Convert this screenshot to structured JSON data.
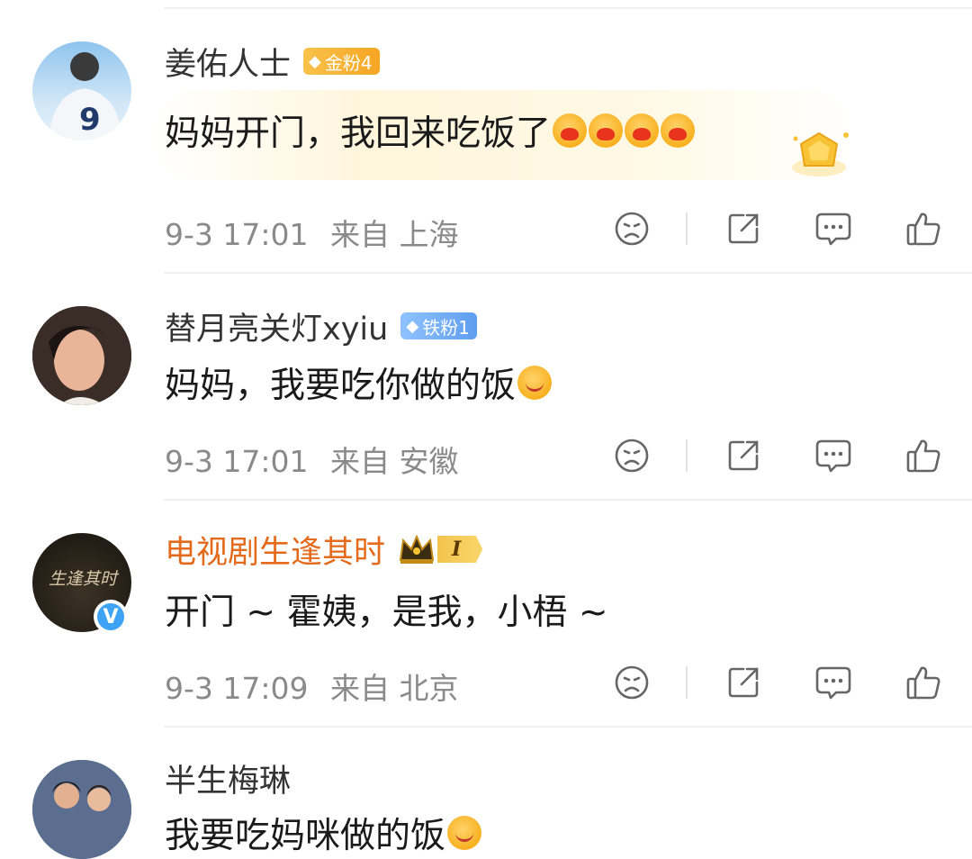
{
  "comments": [
    {
      "username": "姜佑人士",
      "badge": "金粉4",
      "text": "妈妈开门，我回来吃饭了",
      "emojis": [
        "heart",
        "heart",
        "heart",
        "heart"
      ],
      "time": "9-3 17:01",
      "location": "来自 上海"
    },
    {
      "username": "替月亮关灯xyiu",
      "badge": "铁粉1",
      "text": "妈妈，我要吃你做的饭",
      "emojis": [
        "smile"
      ],
      "time": "9-3 17:01",
      "location": "来自 安徽"
    },
    {
      "username": "电视剧生逢其时",
      "badge": "I",
      "text": "开门 ~ 霍姨，是我，小梧 ~",
      "avatar_text": "生逢其时",
      "verified": "V",
      "time": "9-3 17:09",
      "location": "来自 北京"
    },
    {
      "username": "半生梅琳",
      "text": "我要吃妈咪做的饭"
    }
  ],
  "icons": [
    "dislike-icon",
    "share-icon",
    "comment-icon",
    "like-icon"
  ],
  "colors": {
    "accent": "#e46a1c",
    "meta": "#8a8a8a",
    "gold": "#f5a623",
    "iron": "#5e9df0",
    "verified": "#3ea3f5"
  }
}
